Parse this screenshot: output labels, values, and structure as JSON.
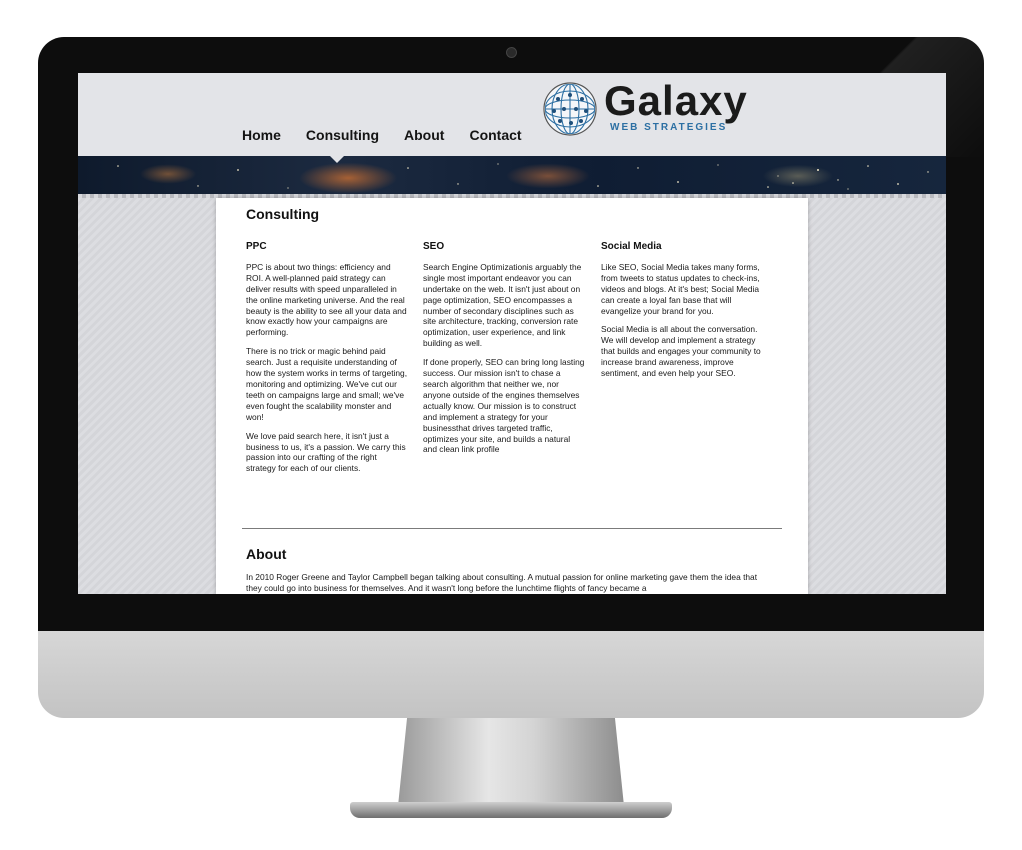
{
  "nav": {
    "items": [
      {
        "label": "Home"
      },
      {
        "label": "Consulting"
      },
      {
        "label": "About"
      },
      {
        "label": "Contact"
      }
    ]
  },
  "logo": {
    "word": "Galaxy",
    "sub": "WEB STRATEGIES",
    "colors": {
      "globe": "#2c6fa3",
      "sub": "#2c6fa3"
    }
  },
  "consulting": {
    "title": "Consulting",
    "columns": [
      {
        "heading": "PPC",
        "paragraphs": [
          "PPC is about two things: efficiency and ROI. A well-planned paid strategy can deliver results with speed unparalleled in the online marketing universe. And the real beauty is the ability to see all your data and know exactly how your campaigns are performing.",
          "There is no trick or magic behind paid search. Just a requisite understanding of how the system works in terms of targeting, monitoring and optimizing. We've cut our teeth on campaigns large and small; we've even fought the scalability monster and won!",
          "We love paid search here, it isn't just a business to us, it's a passion. We carry this passion into our crafting of the right strategy for each of our clients."
        ]
      },
      {
        "heading": "SEO",
        "paragraphs": [
          "Search Engine Optimizationis arguably the single most important endeavor you can undertake on the web. It isn't just about on page optimization, SEO encompasses a number of secondary disciplines such as site architecture, tracking, conversion rate optimization, user experience, and link building as well.",
          "If done properly, SEO can bring long lasting success. Our mission isn't to chase a search algorithm that neither we, nor anyone outside of the engines themselves actually know. Our mission is to construct and implement a strategy for your businessthat drives targeted traffic, optimizes your site, and builds a natural and clean link profile"
        ]
      },
      {
        "heading": "Social Media",
        "paragraphs": [
          "Like SEO, Social Media takes many forms, from tweets to status updates to check-ins, videos and blogs. At it's best; Social Media can create a loyal fan base that will evangelize your brand for you.",
          "Social Media is all about the conversation. We will develop and implement a strategy that builds and engages your community to increase brand awareness, improve sentiment, and even help your SEO."
        ]
      }
    ]
  },
  "about": {
    "title": "About",
    "text": "In 2010 Roger Greene and Taylor Campbell began talking about consulting. A mutual passion for online marketing gave them the idea that they could go into business for themselves. And it wasn't long before the lunchtime flights of fancy became a"
  }
}
